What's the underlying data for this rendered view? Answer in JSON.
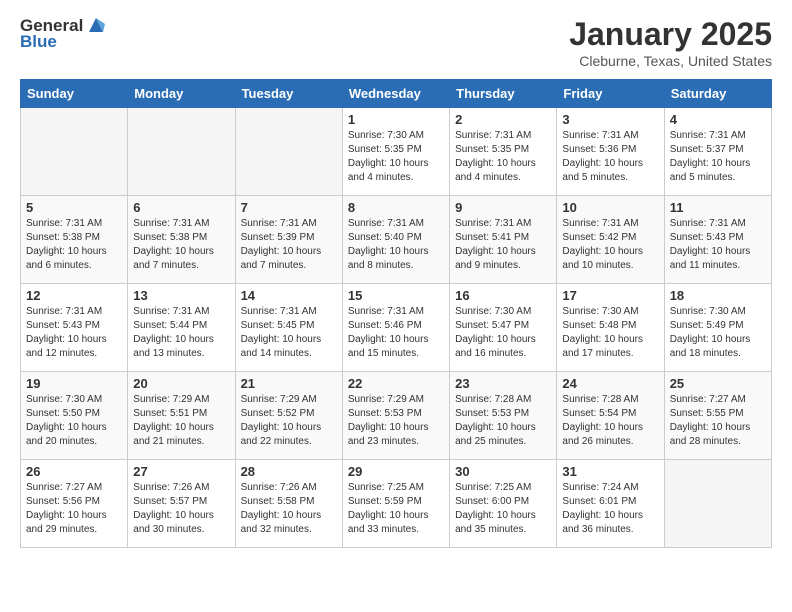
{
  "header": {
    "logo_general": "General",
    "logo_blue": "Blue",
    "title": "January 2025",
    "subtitle": "Cleburne, Texas, United States"
  },
  "weekdays": [
    "Sunday",
    "Monday",
    "Tuesday",
    "Wednesday",
    "Thursday",
    "Friday",
    "Saturday"
  ],
  "weeks": [
    [
      {
        "day": "",
        "info": ""
      },
      {
        "day": "",
        "info": ""
      },
      {
        "day": "",
        "info": ""
      },
      {
        "day": "1",
        "info": "Sunrise: 7:30 AM\nSunset: 5:35 PM\nDaylight: 10 hours\nand 4 minutes."
      },
      {
        "day": "2",
        "info": "Sunrise: 7:31 AM\nSunset: 5:35 PM\nDaylight: 10 hours\nand 4 minutes."
      },
      {
        "day": "3",
        "info": "Sunrise: 7:31 AM\nSunset: 5:36 PM\nDaylight: 10 hours\nand 5 minutes."
      },
      {
        "day": "4",
        "info": "Sunrise: 7:31 AM\nSunset: 5:37 PM\nDaylight: 10 hours\nand 5 minutes."
      }
    ],
    [
      {
        "day": "5",
        "info": "Sunrise: 7:31 AM\nSunset: 5:38 PM\nDaylight: 10 hours\nand 6 minutes."
      },
      {
        "day": "6",
        "info": "Sunrise: 7:31 AM\nSunset: 5:38 PM\nDaylight: 10 hours\nand 7 minutes."
      },
      {
        "day": "7",
        "info": "Sunrise: 7:31 AM\nSunset: 5:39 PM\nDaylight: 10 hours\nand 7 minutes."
      },
      {
        "day": "8",
        "info": "Sunrise: 7:31 AM\nSunset: 5:40 PM\nDaylight: 10 hours\nand 8 minutes."
      },
      {
        "day": "9",
        "info": "Sunrise: 7:31 AM\nSunset: 5:41 PM\nDaylight: 10 hours\nand 9 minutes."
      },
      {
        "day": "10",
        "info": "Sunrise: 7:31 AM\nSunset: 5:42 PM\nDaylight: 10 hours\nand 10 minutes."
      },
      {
        "day": "11",
        "info": "Sunrise: 7:31 AM\nSunset: 5:43 PM\nDaylight: 10 hours\nand 11 minutes."
      }
    ],
    [
      {
        "day": "12",
        "info": "Sunrise: 7:31 AM\nSunset: 5:43 PM\nDaylight: 10 hours\nand 12 minutes."
      },
      {
        "day": "13",
        "info": "Sunrise: 7:31 AM\nSunset: 5:44 PM\nDaylight: 10 hours\nand 13 minutes."
      },
      {
        "day": "14",
        "info": "Sunrise: 7:31 AM\nSunset: 5:45 PM\nDaylight: 10 hours\nand 14 minutes."
      },
      {
        "day": "15",
        "info": "Sunrise: 7:31 AM\nSunset: 5:46 PM\nDaylight: 10 hours\nand 15 minutes."
      },
      {
        "day": "16",
        "info": "Sunrise: 7:30 AM\nSunset: 5:47 PM\nDaylight: 10 hours\nand 16 minutes."
      },
      {
        "day": "17",
        "info": "Sunrise: 7:30 AM\nSunset: 5:48 PM\nDaylight: 10 hours\nand 17 minutes."
      },
      {
        "day": "18",
        "info": "Sunrise: 7:30 AM\nSunset: 5:49 PM\nDaylight: 10 hours\nand 18 minutes."
      }
    ],
    [
      {
        "day": "19",
        "info": "Sunrise: 7:30 AM\nSunset: 5:50 PM\nDaylight: 10 hours\nand 20 minutes."
      },
      {
        "day": "20",
        "info": "Sunrise: 7:29 AM\nSunset: 5:51 PM\nDaylight: 10 hours\nand 21 minutes."
      },
      {
        "day": "21",
        "info": "Sunrise: 7:29 AM\nSunset: 5:52 PM\nDaylight: 10 hours\nand 22 minutes."
      },
      {
        "day": "22",
        "info": "Sunrise: 7:29 AM\nSunset: 5:53 PM\nDaylight: 10 hours\nand 23 minutes."
      },
      {
        "day": "23",
        "info": "Sunrise: 7:28 AM\nSunset: 5:53 PM\nDaylight: 10 hours\nand 25 minutes."
      },
      {
        "day": "24",
        "info": "Sunrise: 7:28 AM\nSunset: 5:54 PM\nDaylight: 10 hours\nand 26 minutes."
      },
      {
        "day": "25",
        "info": "Sunrise: 7:27 AM\nSunset: 5:55 PM\nDaylight: 10 hours\nand 28 minutes."
      }
    ],
    [
      {
        "day": "26",
        "info": "Sunrise: 7:27 AM\nSunset: 5:56 PM\nDaylight: 10 hours\nand 29 minutes."
      },
      {
        "day": "27",
        "info": "Sunrise: 7:26 AM\nSunset: 5:57 PM\nDaylight: 10 hours\nand 30 minutes."
      },
      {
        "day": "28",
        "info": "Sunrise: 7:26 AM\nSunset: 5:58 PM\nDaylight: 10 hours\nand 32 minutes."
      },
      {
        "day": "29",
        "info": "Sunrise: 7:25 AM\nSunset: 5:59 PM\nDaylight: 10 hours\nand 33 minutes."
      },
      {
        "day": "30",
        "info": "Sunrise: 7:25 AM\nSunset: 6:00 PM\nDaylight: 10 hours\nand 35 minutes."
      },
      {
        "day": "31",
        "info": "Sunrise: 7:24 AM\nSunset: 6:01 PM\nDaylight: 10 hours\nand 36 minutes."
      },
      {
        "day": "",
        "info": ""
      }
    ]
  ]
}
